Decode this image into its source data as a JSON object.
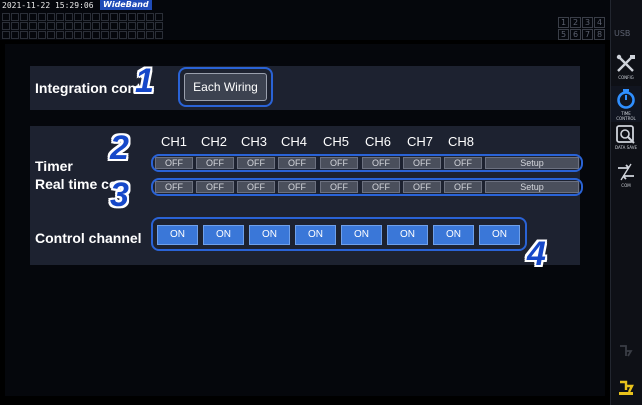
{
  "status": {
    "datetime": "2021-11-22 15:29:06",
    "mode_badge": "WideBand",
    "channel_numbers": [
      "1",
      "2",
      "3",
      "4",
      "5",
      "6",
      "7",
      "8"
    ],
    "usb_label": "USB"
  },
  "integration": {
    "label": "Integration contr",
    "button": "Each Wiring"
  },
  "channels": [
    "CH1",
    "CH2",
    "CH3",
    "CH4",
    "CH5",
    "CH6",
    "CH7",
    "CH8"
  ],
  "timer": {
    "label": "Timer",
    "values": [
      "OFF",
      "OFF",
      "OFF",
      "OFF",
      "OFF",
      "OFF",
      "OFF",
      "OFF"
    ],
    "setup": "Setup"
  },
  "realtime": {
    "label": "Real time co",
    "values": [
      "OFF",
      "OFF",
      "OFF",
      "OFF",
      "OFF",
      "OFF",
      "OFF",
      "OFF"
    ],
    "setup": "Setup"
  },
  "control_channel": {
    "label": "Control channel",
    "values": [
      "ON",
      "ON",
      "ON",
      "ON",
      "ON",
      "ON",
      "ON",
      "ON"
    ]
  },
  "callouts": [
    "1",
    "2",
    "3",
    "4"
  ],
  "sidebar": {
    "items": [
      {
        "caption": "CONFIG",
        "icon": "tools-icon"
      },
      {
        "caption": "TIME CONTROL",
        "icon": "stopwatch-icon"
      },
      {
        "caption": "DATA SAVE",
        "icon": "save-icon"
      },
      {
        "caption": "COM",
        "icon": "com-icon"
      }
    ]
  },
  "colors": {
    "accent_blue": "#3a77d8",
    "callout_blue": "#1648c9",
    "panel": "#1d2230",
    "badge_blue": "#1f4bb8"
  }
}
